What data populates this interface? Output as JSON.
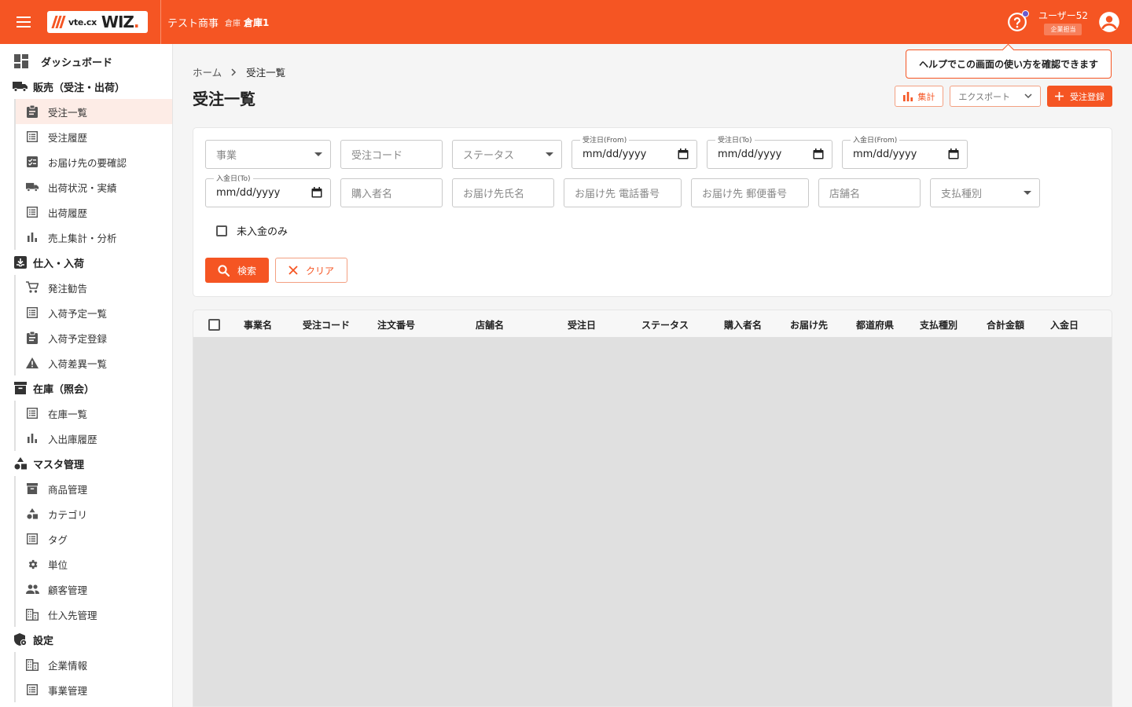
{
  "header": {
    "logo_text": "vte.cx",
    "logo_brand": "WIZ",
    "logo_dot": ".",
    "company": "テスト商事",
    "warehouse_label": "倉庫",
    "warehouse_name": "倉庫1",
    "user_name": "ユーザー52",
    "user_role": "企業担当",
    "accent_color": "#f55523"
  },
  "tooltip": {
    "text": "ヘルプでこの画面の使い方を確認できます"
  },
  "sidebar": {
    "dashboard": "ダッシュボード",
    "sections": [
      {
        "title": "販売（受注・出荷）",
        "items": [
          "受注一覧",
          "受注履歴",
          "お届け先の要確認",
          "出荷状況・実績",
          "出荷履歴",
          "売上集計・分析"
        ]
      },
      {
        "title": "仕入・入荷",
        "items": [
          "発注勧告",
          "入荷予定一覧",
          "入荷予定登録",
          "入荷差異一覧"
        ]
      },
      {
        "title": "在庫（照会）",
        "items": [
          "在庫一覧",
          "入出庫履歴"
        ]
      },
      {
        "title": "マスタ管理",
        "items": [
          "商品管理",
          "カテゴリ",
          "タグ",
          "単位",
          "顧客管理",
          "仕入先管理"
        ]
      },
      {
        "title": "設定",
        "items": [
          "企業情報",
          "事業管理"
        ]
      }
    ]
  },
  "breadcrumb": {
    "home": "ホーム",
    "current": "受注一覧"
  },
  "page": {
    "title": "受注一覧"
  },
  "actions": {
    "aggregate": "集計",
    "export": "エクスポート",
    "register": "受注登録"
  },
  "filters": {
    "business": "事業",
    "order_code": "受注コード",
    "status": "ステータス",
    "order_date_from_label": "受注日(From)",
    "order_date_to_label": "受注日(To)",
    "payment_date_from_label": "入金日(From)",
    "payment_date_to_label": "入金日(To)",
    "date_placeholder": "mm/dd/yyyy",
    "buyer_name": "購入者名",
    "recipient_name": "お届け先氏名",
    "recipient_phone": "お届け先 電話番号",
    "recipient_zip": "お届け先 郵便番号",
    "store_name": "店舗名",
    "payment_type": "支払種別",
    "unpaid_only": "未入金のみ",
    "search": "検索",
    "clear": "クリア"
  },
  "table": {
    "columns": [
      "事業名",
      "受注コード",
      "注文番号",
      "店舗名",
      "受注日",
      "ステータス",
      "購入者名",
      "お届け先",
      "都道府県",
      "支払種別",
      "合計金額",
      "入金日"
    ]
  }
}
